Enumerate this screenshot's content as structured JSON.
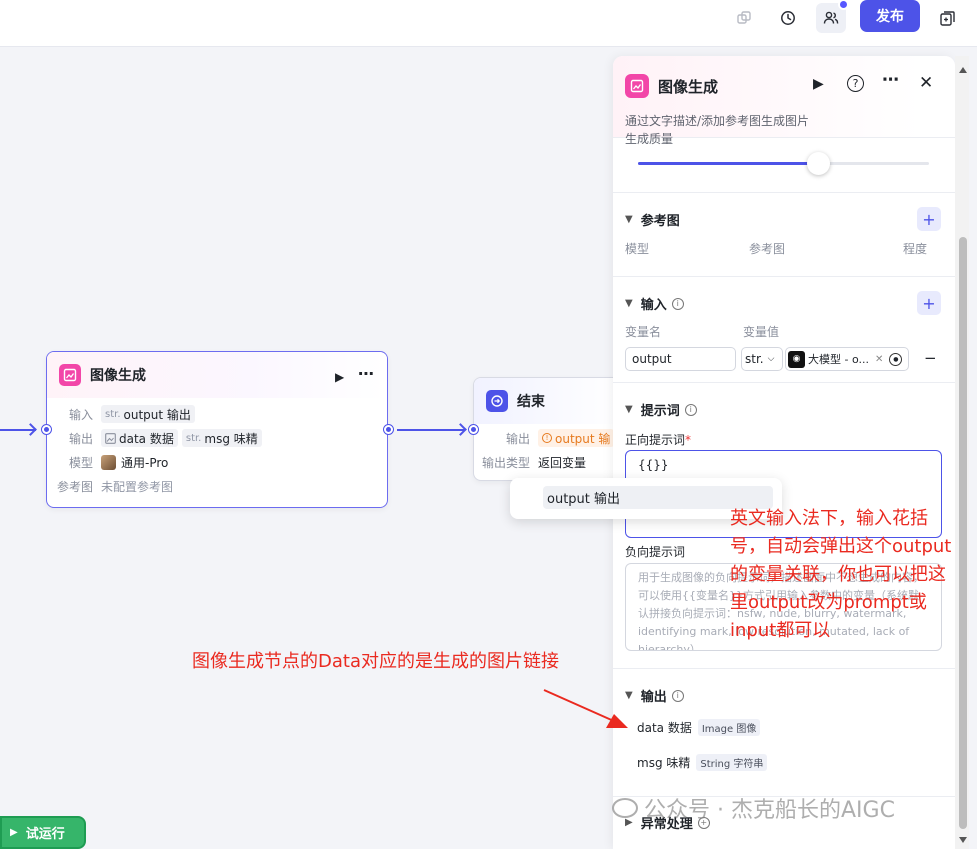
{
  "topbar": {
    "publish_label": "发布"
  },
  "node_image_gen": {
    "title": "图像生成",
    "input_label": "输入",
    "input_type": "str.",
    "input_value": "output 输出",
    "output_label": "输出",
    "output_var1": "data 数据",
    "output_type2": "str.",
    "output_var2": "msg 味精",
    "model_label": "模型",
    "model_value": "通用-Pro",
    "refimg_label": "参考图",
    "refimg_value": "未配置参考图"
  },
  "node_end": {
    "title": "结束",
    "output_label": "输出",
    "output_value": "output 输",
    "output_type_label": "输出类型",
    "output_type_value": "返回变量"
  },
  "popup": {
    "item": "output 输出"
  },
  "panel": {
    "title": "图像生成",
    "subtitle": "通过文字描述/添加参考图生成图片",
    "quality_label": "生成质量",
    "quality_level": 0.62,
    "ref_section": {
      "title": "参考图",
      "col_model": "模型",
      "col_ref": "参考图",
      "col_degree": "程度"
    },
    "input_section": {
      "title": "输入",
      "col_name": "变量名",
      "col_value": "变量值",
      "var_name": "output",
      "var_type": "str.",
      "var_ref": "大模型 - o...",
      "remove": "−"
    },
    "prompt_section": {
      "title": "提示词",
      "positive_label": "正向提示词",
      "positive_required": "*",
      "positive_value": "{{}}",
      "negative_label": "负向提示词",
      "negative_placeholder": "用于生成图像的负向提示词，描述画面中不想生成的内容，可以使用{{变量名}}方式引用输入参数中的变量（系统默认拼接负向提示词：nsfw, nude, blurry, watermark, identifying mark, low resolution, mutated, lack of hierarchy）"
    },
    "output_section": {
      "title": "输出",
      "items": [
        {
          "name": "data 数据",
          "type": "Image 图像"
        },
        {
          "name": "msg 味精",
          "type": "String 字符串"
        }
      ]
    },
    "error_section": {
      "title": "异常处理"
    }
  },
  "annotations": {
    "right_note": "英文输入法下，输入花括号，自动会弹出这个output的变量关联，你也可以把这里output改为prompt或input都可以",
    "left_note": "图像生成节点的Data对应的是生成的图片链接"
  },
  "watermark": "公众号 · 杰克船长的AIGC",
  "trial_run_label": "试运行",
  "colors": {
    "accent": "#4d53e8",
    "image_node": "#f246a8",
    "end_node": "#4d53e8",
    "annotation": "#ea2a20",
    "trial_green": "#36b56a"
  }
}
